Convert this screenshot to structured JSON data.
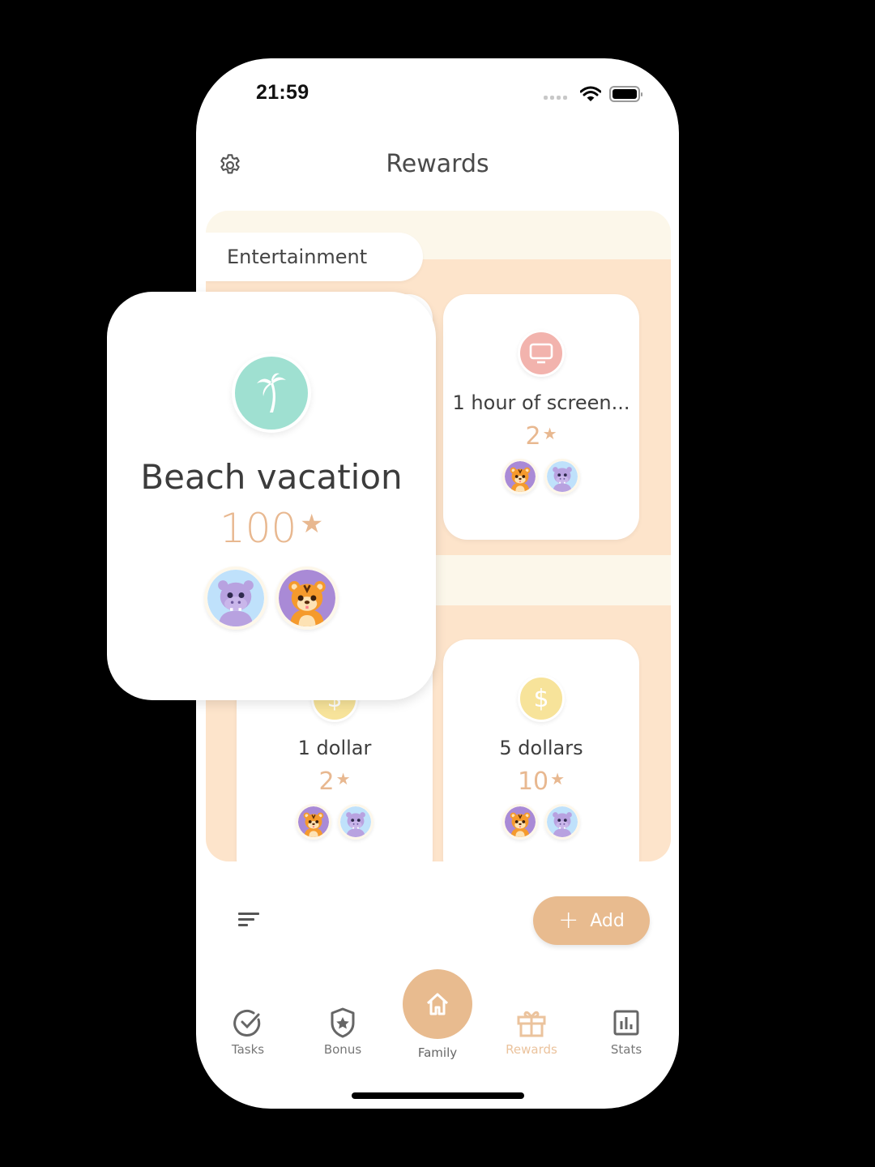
{
  "status_bar": {
    "time": "21:59",
    "icons": [
      "signal-dots-icon",
      "wifi-icon",
      "battery-icon"
    ]
  },
  "header": {
    "title": "Rewards",
    "settings_icon": "gear-icon"
  },
  "categories": [
    {
      "name": "Entertainment"
    }
  ],
  "rewards": [
    {
      "title": "Beach vacation",
      "cost": "100",
      "icon": "palm-tree-icon",
      "icon_color": "#9fe0d1",
      "assigned": [
        "hippo",
        "tiger"
      ],
      "highlighted": true
    },
    {
      "title": "1 hour of screen...",
      "cost": "2",
      "icon": "monitor-icon",
      "icon_color": "#f2b3ad",
      "assigned": [
        "tiger",
        "hippo"
      ]
    },
    {
      "title": "1 dollar",
      "cost": "2",
      "icon": "dollar-icon",
      "icon_color": "#f7e39a",
      "assigned": [
        "tiger",
        "hippo"
      ]
    },
    {
      "title": "5 dollars",
      "cost": "10",
      "icon": "dollar-icon",
      "icon_color": "#f7e39a",
      "assigned": [
        "tiger",
        "hippo"
      ]
    }
  ],
  "star_symbol": "★",
  "toolbar": {
    "sort_icon": "sort-icon",
    "add_label": "Add",
    "add_plus": "+"
  },
  "tabbar": {
    "items": [
      {
        "label": "Tasks",
        "icon": "check-circle-icon"
      },
      {
        "label": "Bonus",
        "icon": "shield-star-icon"
      },
      {
        "label": "Family",
        "icon": "home-icon"
      },
      {
        "label": "Rewards",
        "icon": "gift-icon",
        "active": true
      },
      {
        "label": "Stats",
        "icon": "bar-chart-icon"
      }
    ]
  },
  "colors": {
    "accent": "#e8bb8f",
    "star": "#e8b890",
    "band_light": "#fcf7ea",
    "band_peach": "#fde4cb",
    "active_tab": "#ebc39d"
  }
}
